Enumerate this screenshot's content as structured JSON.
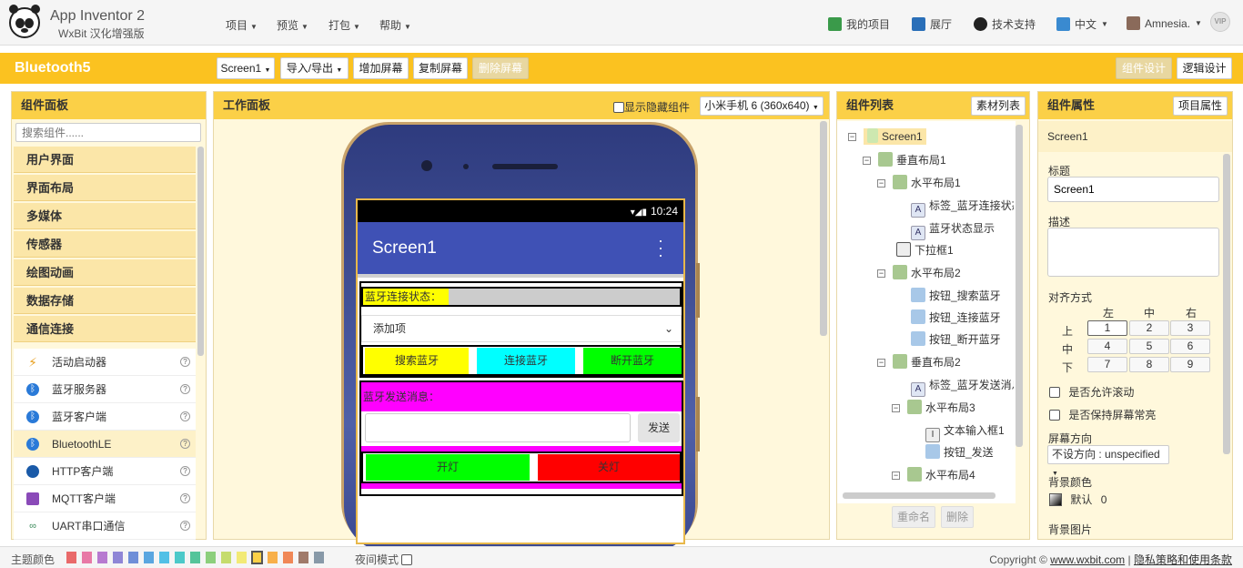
{
  "app": {
    "name": "App Inventor 2",
    "subtitle": "WxBit 汉化增强版"
  },
  "top_menu": [
    {
      "label": "项目"
    },
    {
      "label": "预览"
    },
    {
      "label": "打包"
    },
    {
      "label": "帮助"
    }
  ],
  "right_menu": {
    "my_projects": "我的项目",
    "gallery": "展厅",
    "support": "技术支持",
    "language": "中文",
    "user": "Amnesia.",
    "vip": "VIP"
  },
  "project": {
    "name": "Bluetooth5",
    "screen_select": "Screen1",
    "import_export": "导入/导出",
    "add_screen": "增加屏幕",
    "copy_screen": "复制屏幕",
    "delete_screen": "删除屏幕",
    "designer": "组件设计",
    "blocks": "逻辑设计"
  },
  "palette": {
    "title": "组件面板",
    "search_placeholder": "搜索组件......",
    "categories": [
      "用户界面",
      "界面布局",
      "多媒体",
      "传感器",
      "绘图动画",
      "数据存储",
      "通信连接"
    ],
    "components": [
      "活动启动器",
      "蓝牙服务器",
      "蓝牙客户端",
      "BluetoothLE",
      "HTTP客户端",
      "MQTT客户端",
      "UART串口通信"
    ]
  },
  "viewer": {
    "title": "工作面板",
    "show_hidden": "显示隐藏组件",
    "device": "小米手机 6 (360x640)",
    "phone": {
      "time": "10:24",
      "screen_title": "Screen1",
      "bt_status_label": "蓝牙连接状态：",
      "list_picker": "添加项",
      "btn_search": "搜索蓝牙",
      "btn_connect": "连接蓝牙",
      "btn_disconnect": "断开蓝牙",
      "send_label": "蓝牙发送消息：",
      "send_button": "发送",
      "btn_on": "开灯",
      "btn_off": "关灯"
    }
  },
  "tree": {
    "title": "组件列表",
    "assets_btn": "素材列表",
    "nodes": [
      {
        "label": "Screen1"
      },
      {
        "label": "垂直布局1"
      },
      {
        "label": "水平布局1"
      },
      {
        "label": "标签_蓝牙连接状态"
      },
      {
        "label": "蓝牙状态显示"
      },
      {
        "label": "下拉框1"
      },
      {
        "label": "水平布局2"
      },
      {
        "label": "按钮_搜索蓝牙"
      },
      {
        "label": "按钮_连接蓝牙"
      },
      {
        "label": "按钮_断开蓝牙"
      },
      {
        "label": "垂直布局2"
      },
      {
        "label": "标签_蓝牙发送消息"
      },
      {
        "label": "水平布局3"
      },
      {
        "label": "文本输入框1"
      },
      {
        "label": "按钮_发送"
      },
      {
        "label": "水平布局4"
      }
    ],
    "rename": "重命名",
    "delete": "删除"
  },
  "properties": {
    "title": "组件属性",
    "project_btn": "项目属性",
    "component": "Screen1",
    "title_label": "标题",
    "title_value": "Screen1",
    "desc_label": "描述",
    "align_label": "对齐方式",
    "align_cols": [
      "左",
      "中",
      "右"
    ],
    "align_rows": [
      "上",
      "中",
      "下"
    ],
    "align_cells": [
      "1",
      "2",
      "3",
      "4",
      "5",
      "6",
      "7",
      "8",
      "9"
    ],
    "scroll_label": "是否允许滚动",
    "keep_on_label": "是否保持屏幕常亮",
    "orientation_label": "屏幕方向",
    "orientation_value": "不设方向 : unspecified",
    "bg_color_label": "背景颜色",
    "bg_color_value": "默认",
    "bg_color_num": "0",
    "bg_image_label": "背景图片"
  },
  "footer": {
    "theme_label": "主题颜色",
    "night_mode": "夜间模式",
    "copyright": "Copyright ©",
    "site": "www.wxbit.com",
    "sep": "|",
    "privacy": "隐私策略和使用条款",
    "swatches": [
      "#e96a6a",
      "#e879a6",
      "#b77ad0",
      "#8f86d6",
      "#6f8fd8",
      "#5aa6e0",
      "#52c0e6",
      "#4cc9c9",
      "#55c49a",
      "#8ccf7c",
      "#c5dc6d",
      "#f2ea76",
      "#fbd047",
      "#f8b04a",
      "#f08756",
      "#a07a6a",
      "#8899a8"
    ]
  }
}
